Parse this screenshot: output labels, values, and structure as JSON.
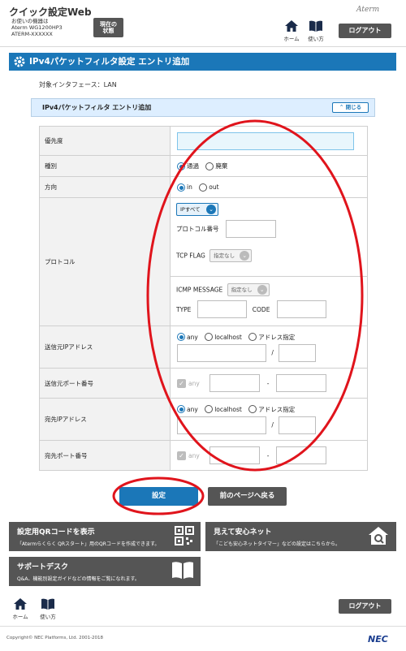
{
  "header": {
    "app_title": "クイック設定Web",
    "device_lines": [
      "お使いの機器は",
      "Aterm WG1200HP3",
      "ATERM-XXXXXX"
    ],
    "status_button": [
      "現在の",
      "状態"
    ],
    "brand": "Aterm",
    "home_label": "ホーム",
    "help_label": "使い方",
    "logout_label": "ログアウト"
  },
  "page": {
    "title": "IPv4パケットフィルタ設定 エントリ追加",
    "interface_text": "対象インタフェース：LAN",
    "section_title": "IPv4パケットフィルタ エントリ追加",
    "close_label": "閉じる"
  },
  "form": {
    "priority_label": "優先度",
    "priority_value": "",
    "type_label": "種別",
    "type_options": [
      "通過",
      "廃棄"
    ],
    "type_selected": "通過",
    "direction_label": "方向",
    "direction_options": [
      "in",
      "out"
    ],
    "direction_selected": "in",
    "protocol_label": "プロトコル",
    "protocol_select": "IPすべて",
    "protocol_number_label": "プロトコル番号",
    "tcp_flag_label": "TCP FLAG",
    "tcp_flag_select": "指定なし",
    "icmp_label": "ICMP MESSAGE",
    "icmp_select": "指定なし",
    "icmp_type_label": "TYPE",
    "icmp_code_label": "CODE",
    "src_ip_label": "送信元IPアドレス",
    "dst_ip_label": "宛先IPアドレス",
    "addr_options": [
      "any",
      "localhost",
      "アドレス指定"
    ],
    "addr_selected": "any",
    "slash": "/",
    "src_port_label": "送信元ポート番号",
    "dst_port_label": "宛先ポート番号",
    "port_any_label": "any",
    "dash": "-"
  },
  "buttons": {
    "submit": "設定",
    "back": "前のページへ戻る"
  },
  "tiles": {
    "qr_title": "設定用QRコードを表示",
    "qr_desc": "「Atermらくらく QRスタート」用のQRコードを作成できます。",
    "net_title": "見えて安心ネット",
    "net_desc": "「こども安心ネットタイマー」などの設定はこちらから。",
    "support_title": "サポートデスク",
    "support_desc": "Q&A、機能別設定ガイドなどの情報をご覧になれます。"
  },
  "footer": {
    "copyright": "Copyright© NEC Platforms, Ltd. 2001-2018",
    "nec": "NEC"
  },
  "colors": {
    "accent": "#1b77b8",
    "dark_button": "#555555",
    "annotation": "#e0141c"
  }
}
